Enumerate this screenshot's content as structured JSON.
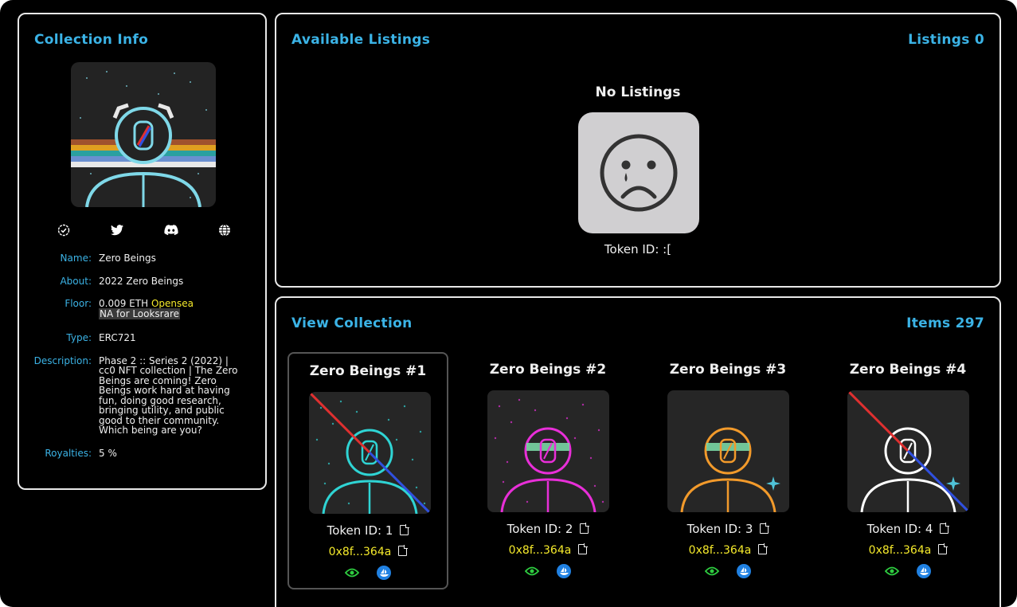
{
  "colors": {
    "accent": "#3bb3e6",
    "address": "#f5ea2b",
    "opensea": "#2081e2",
    "eye": "#2ecc40"
  },
  "info": {
    "title": "Collection Info",
    "socials": [
      "verified-icon",
      "twitter-icon",
      "discord-icon",
      "globe-icon"
    ],
    "name_label": "Name:",
    "name": "Zero Beings",
    "about_label": "About:",
    "about": "2022 Zero Beings",
    "floor_label": "Floor:",
    "floor_eth": "0.009 ETH",
    "floor_source": "Opensea",
    "floor_looksrare": "NA for Looksrare",
    "type_label": "Type:",
    "type": "ERC721",
    "description_label": "Description:",
    "description": "Phase 2 :: Series 2 (2022) | cc0 NFT collection | The Zero Beings are coming! Zero Beings work hard at having fun, doing good research, bringing utility, and public good to their community. Which being are you?",
    "royalties_label": "Royalties:",
    "royalties": "5 %"
  },
  "listings": {
    "title": "Available Listings",
    "count_label": "Listings 0",
    "empty_title": "No Listings",
    "token_label": "Token ID: :["
  },
  "collection": {
    "title": "View Collection",
    "count_label": "Items 297",
    "items": [
      {
        "name": "Zero Beings #1",
        "token": "Token ID: 1",
        "address": "0x8f...364a",
        "color": "#2fd4d4"
      },
      {
        "name": "Zero Beings #2",
        "token": "Token ID: 2",
        "address": "0x8f...364a",
        "color": "#e82fd8"
      },
      {
        "name": "Zero Beings #3",
        "token": "Token ID: 3",
        "address": "0x8f...364a",
        "color": "#f29a2b"
      },
      {
        "name": "Zero Beings #4",
        "token": "Token ID: 4",
        "address": "0x8f...364a",
        "color": "#ffffff"
      }
    ]
  }
}
